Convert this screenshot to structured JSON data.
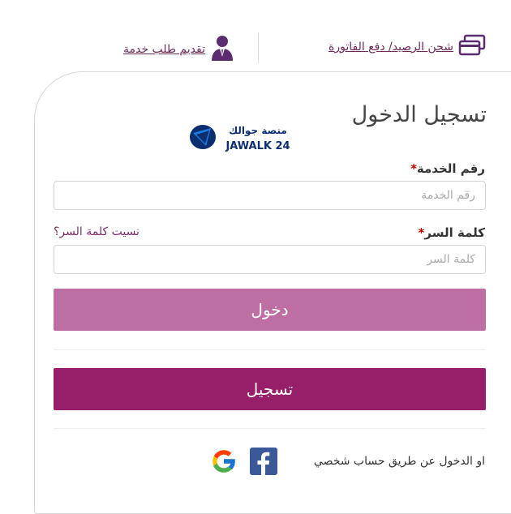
{
  "top_links": {
    "recharge_label": "شحن الرصيد/ دفع الفاتورة",
    "service_request_label": "تقديم طلب خدمة"
  },
  "logo": {
    "text": "JAWALK 24",
    "arabic_text": "منصة جوالك"
  },
  "login": {
    "title": "تسجيل الدخول",
    "service_number_label": "رقم الخدمة",
    "service_number_placeholder": "رقم الخدمة",
    "service_number_value": "",
    "password_label": "كلمة السر",
    "password_placeholder": "كلمة السر",
    "password_value": "",
    "required_marker": "*",
    "forgot_password": "نسيت كلمة السر؟",
    "login_button": "دخول",
    "register_button": "تسجيل",
    "social_text": "او الدخول عن طريق حساب شخصي"
  },
  "colors": {
    "accent_purple": "#971f69",
    "login_button": "#bd6fa4",
    "link_purple": "#7b2f69",
    "facebook_blue": "#3b5998"
  },
  "icons": [
    "card-icon",
    "user-icon",
    "facebook-icon",
    "google-icon"
  ]
}
